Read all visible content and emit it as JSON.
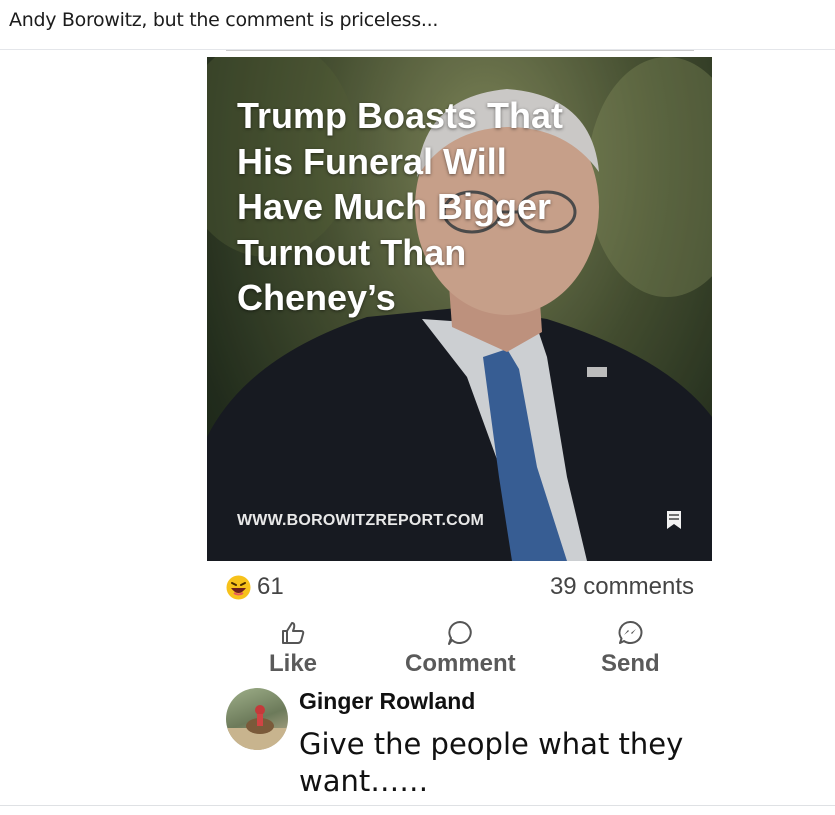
{
  "post": {
    "caption": "Andy Borowitz, but the comment is priceless..."
  },
  "shared_image": {
    "headline": "Trump Boasts That His Funeral Will Have Much Bigger Turnout Than Cheney's",
    "headline_lines": "Trump Boasts That\nHis Funeral Will\nHave Much Bigger\nTurnout Than\nCheney’s",
    "watermark": "WWW.BOROWITZREPORT.COM"
  },
  "stats": {
    "reaction_count": "61",
    "comments": "39 comments"
  },
  "actions": {
    "like": "Like",
    "comment": "Comment",
    "send": "Send"
  },
  "comment": {
    "author": "Ginger Rowland",
    "text": "Give the people what they want……"
  },
  "colors": {
    "text_primary": "#111111",
    "text_secondary": "#555555",
    "divider": "#e4e6ea",
    "reaction_yellow": "#f7c21b"
  }
}
